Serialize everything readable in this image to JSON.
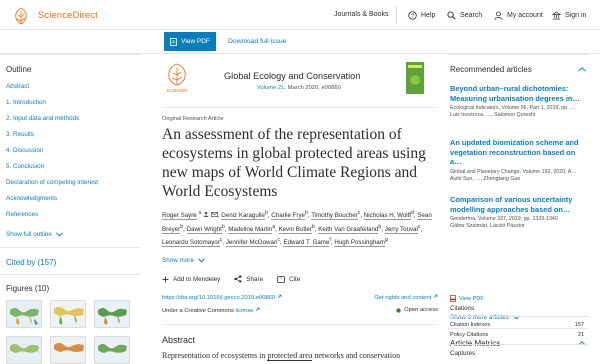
{
  "header": {
    "brand": "ScienceDirect",
    "journals_books": "Journals & Books",
    "help": "Help",
    "search": "Search",
    "my_account": "My account",
    "sign_in": "Sign in"
  },
  "actions": {
    "view_pdf": "View PDF",
    "download_issue": "Download full issue"
  },
  "outline": {
    "title": "Outline",
    "items": [
      "Abstract",
      "1. Introduction",
      "2. Input data and methods",
      "3. Results",
      "4. Discussion",
      "5. Conclusion",
      "Declaration of competing interest",
      "Acknowledgments",
      "References"
    ],
    "show_full": "Show full outline"
  },
  "cited_by": "Cited by (157)",
  "figures_title": "Figures (10)",
  "journal": {
    "name": "Global Ecology and Conservation",
    "issue": "Volume 21",
    "date": ", March 2020, e00860",
    "publisher": "ELSEVIER"
  },
  "article": {
    "type": "Original Research Article",
    "title": "An assessment of the representation of ecosystems in global protected areas using new maps of World Climate Regions and World Ecosystems",
    "authors": [
      {
        "name": "Roger Sayre",
        "sup": "a"
      },
      {
        "name": "Deniz Karagulle",
        "sup": "b"
      },
      {
        "name": "Charlie Frye",
        "sup": "b"
      },
      {
        "name": "Timothy Boucher",
        "sup": "c"
      },
      {
        "name": "Nicholas H. Wolff",
        "sup": "d"
      },
      {
        "name": "Sean Breyer",
        "sup": "b"
      },
      {
        "name": "Dawn Wright",
        "sup": "b"
      },
      {
        "name": "Madeline Martin",
        "sup": "a"
      },
      {
        "name": "Kevin Butler",
        "sup": "b"
      },
      {
        "name": "Keith Van Graafeiland",
        "sup": "b"
      },
      {
        "name": "Jerry Touval",
        "sup": "c"
      },
      {
        "name": "Leonardo Sotomayor",
        "sup": "c"
      },
      {
        "name": "Jennifer McGowan",
        "sup": "c"
      },
      {
        "name": "Edward T. Game",
        "sup": "f"
      },
      {
        "name": "Hugh Possingham",
        "sup": "g"
      }
    ],
    "show_more": "Show more",
    "add_mendeley": "Add to Mendeley",
    "share": "Share",
    "cite": "Cite",
    "doi": "https://doi.org/10.1016/j.gecco.2019.e00860",
    "rights": "Get rights and content",
    "license_prefix": "Under a Creative Commons",
    "license_link": "license",
    "open_access": "Open access",
    "abstract_title": "Abstract",
    "abstract_start": "Representation of ecosystems in",
    "abstract_link": "protected area",
    "abstract_end": "networks and conservation"
  },
  "recommended": {
    "title": "Recommended articles",
    "items": [
      {
        "title": "Beyond urban–rural dichotomies: Measuring urbanisation degrees in…",
        "meta": "Ecological Indicators, Volume 96, Part 1, 2019, pp. …",
        "authors": "Luis Inostroza, …, Salomon Qureshi"
      },
      {
        "title": "An updated biomization scheme and vegetation reconstruction based on a…",
        "meta": "Global and Planetary Change, Volume 192, 2020, A…",
        "authors": "Aizhi Sun, …, Zhengtang Guo"
      },
      {
        "title": "Comparison of various uncertainty modelling approaches based on…",
        "meta": "Geoderma, Volume 337, 2019, pp. 1329-1340",
        "authors": "Gábor Szatmári, László Pásztor"
      }
    ],
    "view_pdf": "View PDF",
    "show_more": "Show 3 more articles"
  },
  "metrics": {
    "title": "Article Metrics",
    "citations_label": "Citations",
    "rows": [
      {
        "label": "Citation Indexes",
        "value": "157"
      },
      {
        "label": "Policy Citations",
        "value": "21"
      }
    ],
    "captures_label": "Captures"
  },
  "colors": {
    "brand": "#e9711c",
    "link": "#0c7dbb",
    "cover": "#5ea23a"
  }
}
